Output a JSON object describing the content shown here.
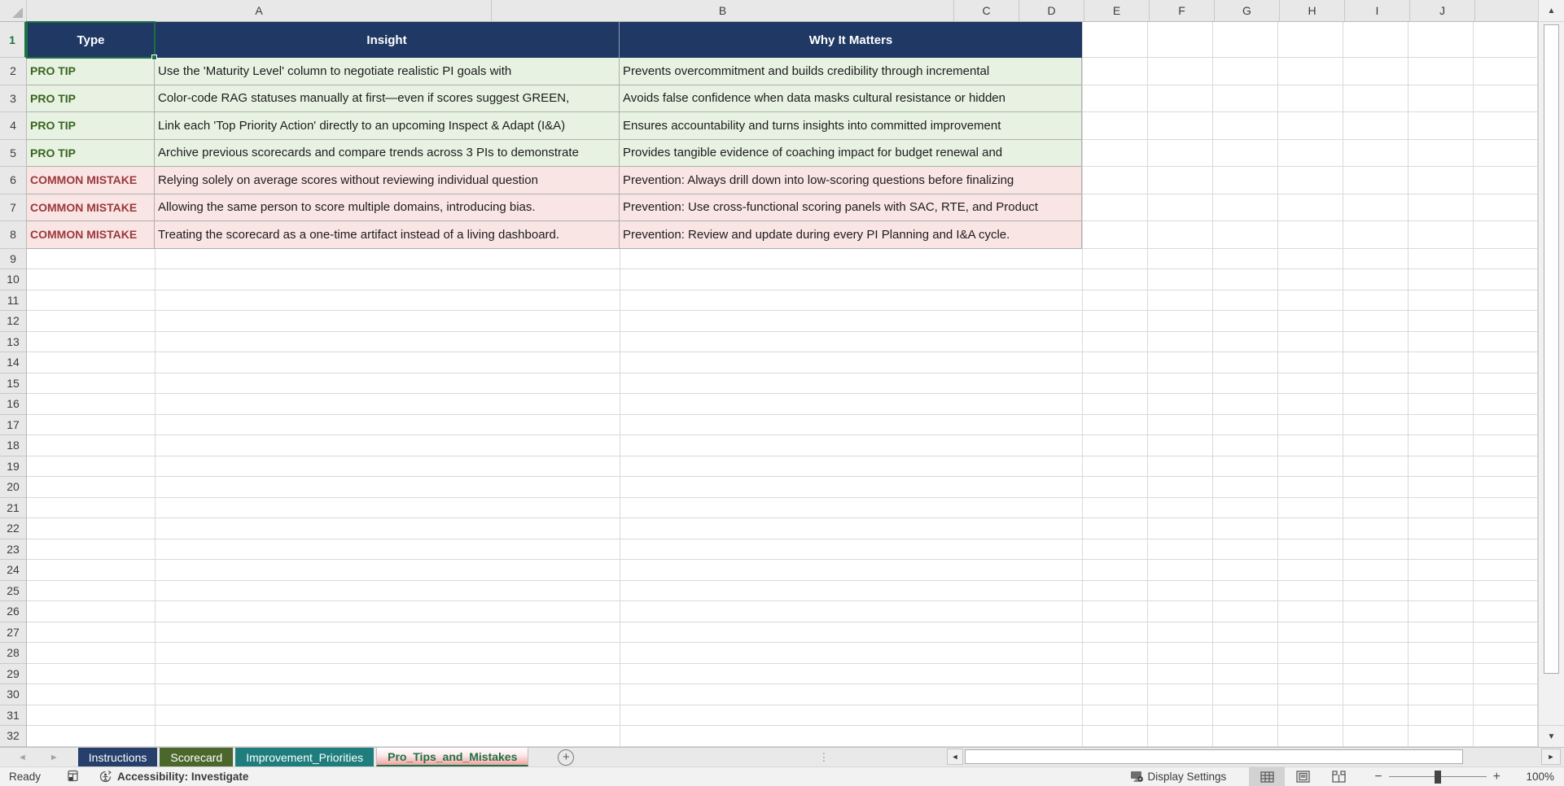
{
  "colors": {
    "header_fill": "#1F3864",
    "tip_fill": "#E8F2E2",
    "tip_text": "#39641E",
    "mistake_fill": "#FAE5E5",
    "mistake_text": "#9B383B",
    "selection_green": "#1E7145",
    "tab_navy": "#263F6B",
    "tab_olive": "#4C672C",
    "tab_teal": "#1F7E7D",
    "tab_active_pink": "#F2A2A2"
  },
  "columns": [
    "A",
    "B",
    "C",
    "D",
    "E",
    "F",
    "G",
    "H",
    "I",
    "J"
  ],
  "rows": [
    "1",
    "2",
    "3",
    "4",
    "5",
    "6",
    "7",
    "8",
    "9",
    "10",
    "11",
    "12",
    "13",
    "14",
    "15",
    "16",
    "17",
    "18",
    "19",
    "20",
    "21",
    "22",
    "23",
    "24",
    "25",
    "26",
    "27",
    "28",
    "29",
    "30",
    "31",
    "32"
  ],
  "table": {
    "headers": {
      "type": "Type",
      "insight": "Insight",
      "why": "Why It Matters"
    },
    "entries": [
      {
        "kind": "tip",
        "type": "PRO TIP",
        "insight": "Use the 'Maturity Level' column to negotiate realistic PI goals with",
        "why": "Prevents overcommitment and builds credibility through incremental"
      },
      {
        "kind": "tip",
        "type": "PRO TIP",
        "insight": "Color-code RAG statuses manually at first—even if scores suggest GREEN,",
        "why": "Avoids false confidence when data masks cultural resistance or hidden"
      },
      {
        "kind": "tip",
        "type": "PRO TIP",
        "insight": "Link each 'Top Priority Action' directly to an upcoming Inspect & Adapt (I&A)",
        "why": "Ensures accountability and turns insights into committed improvement"
      },
      {
        "kind": "tip",
        "type": "PRO TIP",
        "insight": "Archive previous scorecards and compare trends across 3 PIs to demonstrate",
        "why": "Provides tangible evidence of coaching impact for budget renewal and"
      },
      {
        "kind": "mistake",
        "type": "COMMON MISTAKE",
        "insight": "Relying solely on average scores without reviewing individual question",
        "why": "Prevention: Always drill down into low-scoring questions before finalizing"
      },
      {
        "kind": "mistake",
        "type": "COMMON MISTAKE",
        "insight": "Allowing the same person to score multiple domains, introducing bias.",
        "why": "Prevention: Use cross-functional scoring panels with SAC, RTE, and Product"
      },
      {
        "kind": "mistake",
        "type": "COMMON MISTAKE",
        "insight": "Treating the scorecard as a one-time artifact instead of a living dashboard.",
        "why": "Prevention: Review and update during every PI Planning and I&A cycle."
      }
    ]
  },
  "sheet_tabs": [
    {
      "label": "Instructions",
      "kind": "tab-navy"
    },
    {
      "label": "Scorecard",
      "kind": "tab-olive"
    },
    {
      "label": "Improvement_Priorities",
      "kind": "tab-teal"
    },
    {
      "label": "Pro_Tips_and_Mistakes",
      "kind": "tab-active"
    }
  ],
  "icons": {
    "add_sheet": "+",
    "nav_prev": "◄",
    "nav_next": "►",
    "scroll_up": "▲",
    "scroll_down": "▼",
    "scroll_left": "◄",
    "scroll_right": "►",
    "dots": "⋮",
    "zoom_minus": "−",
    "zoom_plus": "+"
  },
  "status_bar": {
    "ready": "Ready",
    "accessibility": "Accessibility: Investigate",
    "display_settings": "Display Settings",
    "zoom_level": "100%"
  }
}
